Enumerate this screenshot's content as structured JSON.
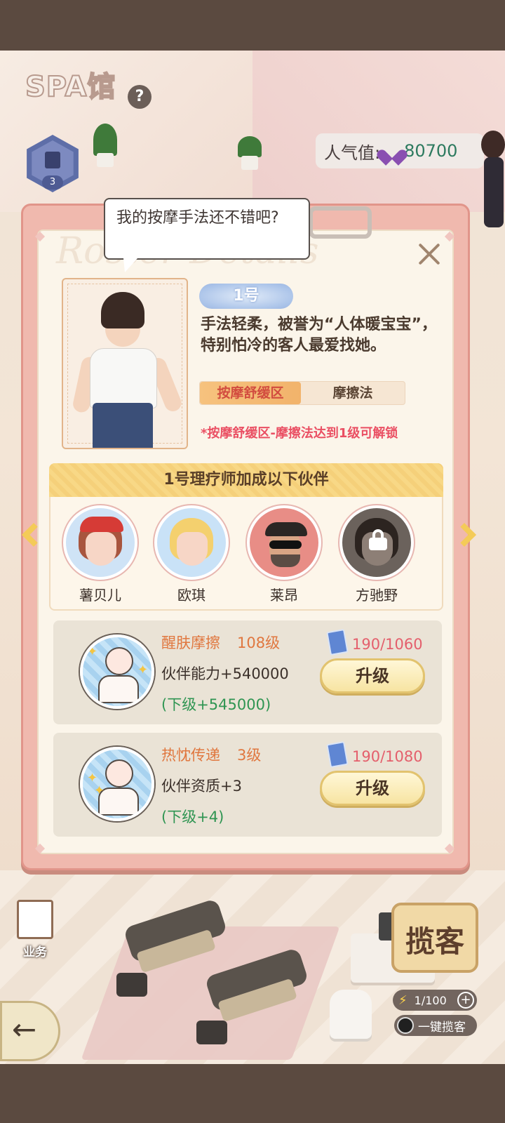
{
  "scene": {
    "title": "SPA馆",
    "help_icon": "question-icon",
    "level": "3",
    "popularity_label": "人气值:",
    "popularity_value": "80700",
    "business_label": "业务",
    "solicit_label": "揽客",
    "energy_text": "1/100",
    "one_key_label": "一键揽客"
  },
  "modal": {
    "speech": "我的按摩手法还不错吧?",
    "watermark": "Roster Details",
    "number_badge": "1号",
    "description": "手法轻柔，被誉为“人体暖宝宝”，特别怕冷的客人最爱找她。",
    "tag_area": "按摩舒缓区",
    "tag_method": "摩擦法",
    "unlock_note": "*按摩舒缓区-摩擦法达到1级可解锁",
    "partners_title": "1号理疗师加成以下伙伴",
    "partners": [
      {
        "name": "薯贝儿",
        "locked": false
      },
      {
        "name": "欧琪",
        "locked": false
      },
      {
        "name": "莱昂",
        "locked": false
      },
      {
        "name": "方驰野",
        "locked": true
      }
    ],
    "skills": [
      {
        "name": "醒肤摩擦",
        "level": "108级",
        "effect": "伙伴能力+540000",
        "next": "(下级+545000)",
        "cost": "190/1060",
        "button": "升级"
      },
      {
        "name": "热忱传递",
        "level": "3级",
        "effect": "伙伴资质+3",
        "next": "(下级+4)",
        "cost": "190/1080",
        "button": "升级"
      }
    ]
  },
  "colors": {
    "modal_border": "#f0b9ae",
    "skill_name": "#e0773f",
    "next_level": "#2f9552",
    "cost": "#e45f6c",
    "unlock_note": "#ea4f63"
  }
}
